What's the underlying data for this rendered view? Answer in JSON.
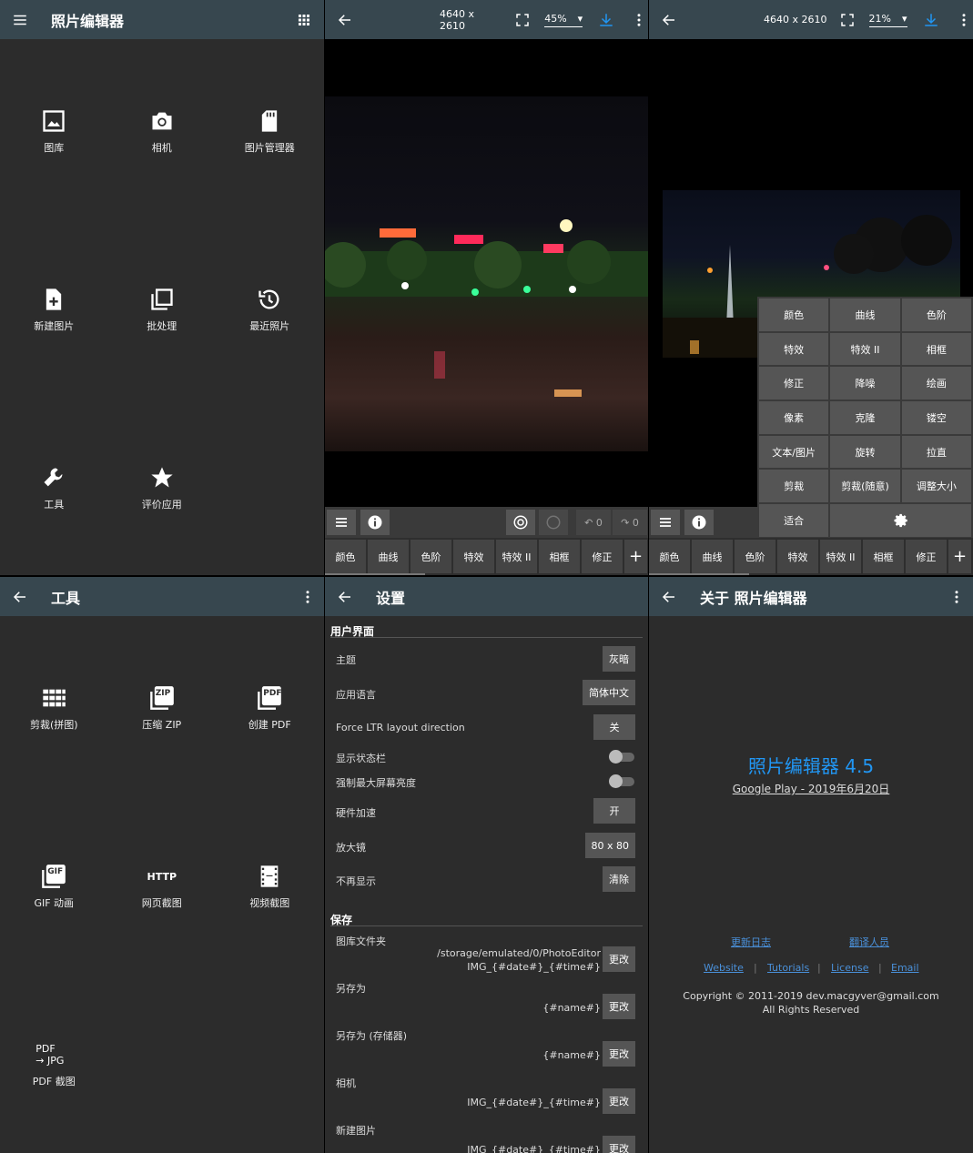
{
  "home": {
    "title": "照片编辑器",
    "items": [
      {
        "label": "图库",
        "icon": "image-icon"
      },
      {
        "label": "相机",
        "icon": "camera-icon"
      },
      {
        "label": "图片管理器",
        "icon": "sd-card-icon"
      },
      {
        "label": "新建图片",
        "icon": "new-file-icon"
      },
      {
        "label": "批处理",
        "icon": "stack-icon"
      },
      {
        "label": "最近照片",
        "icon": "history-icon"
      },
      {
        "label": "工具",
        "icon": "wrench-icon"
      },
      {
        "label": "评价应用",
        "icon": "star-icon"
      }
    ]
  },
  "editor1": {
    "dims": "4640 x 2610",
    "zoom": "45%",
    "undo": "0",
    "redo": "0",
    "tabs": [
      "颜色",
      "曲线",
      "色阶",
      "特效",
      "特效 II",
      "相框",
      "修正"
    ]
  },
  "editor2": {
    "dims": "4640 x 2610",
    "zoom": "21%",
    "tabs": [
      "颜色",
      "曲线",
      "色阶",
      "特效",
      "特效 II",
      "相框",
      "修正"
    ],
    "menu": [
      "颜色",
      "曲线",
      "色阶",
      "特效",
      "特效 II",
      "相框",
      "修正",
      "降噪",
      "绘画",
      "像素",
      "克隆",
      "镂空",
      "文本/图片",
      "旋转",
      "拉直",
      "剪裁",
      "剪裁(随意)",
      "调整大小",
      "适合"
    ]
  },
  "tools": {
    "title": "工具",
    "items": [
      {
        "label": "剪裁(拼图)",
        "icon": "grid-icon"
      },
      {
        "label": "压缩 ZIP",
        "icon": "zip-icon",
        "badge": "ZIP"
      },
      {
        "label": "创建 PDF",
        "icon": "pdf-icon",
        "badge": "PDF"
      },
      {
        "label": "GIF 动画",
        "icon": "gif-icon",
        "badge": "GIF"
      },
      {
        "label": "网页截图",
        "icon": "http-icon",
        "badge": "HTTP"
      },
      {
        "label": "视频截图",
        "icon": "film-icon"
      },
      {
        "label": "PDF 截图",
        "icon": "pdf-to-jpg-icon",
        "badge1": "PDF",
        "badge2": "→ JPG"
      }
    ]
  },
  "settings": {
    "title": "设置",
    "ui_section": "用户界面",
    "theme_label": "主题",
    "theme_value": "灰暗",
    "lang_label": "应用语言",
    "lang_value": "简体中文",
    "ltr_label": "Force LTR layout direction",
    "ltr_value": "关",
    "statusbar_label": "显示状态栏",
    "brightness_label": "强制最大屏幕亮度",
    "hw_label": "硬件加速",
    "hw_value": "开",
    "magnifier_label": "放大镜",
    "magnifier_value": "80 x 80",
    "nomore_label": "不再显示",
    "nomore_value": "清除",
    "save_section": "保存",
    "gallery_label": "图库文件夹",
    "gallery_path1": "/storage/emulated/0/PhotoEditor",
    "gallery_path2": "IMG_{#date#}_{#time#}",
    "saveas_label": "另存为",
    "saveas_value": "{#name#}",
    "saveas_storage_label": "另存为 (存储器)",
    "saveas_storage_value": "{#name#}",
    "camera_label": "相机",
    "camera_value": "IMG_{#date#}_{#time#}",
    "newimg_label": "新建图片",
    "newimg_value": "IMG_{#date#}_{#time#}",
    "change": "更改"
  },
  "about": {
    "title": "关于 照片编辑器",
    "app_name": "照片编辑器 4.5",
    "release": "Google Play - 2019年6月20日",
    "changelog": "更新日志",
    "translators": "翻译人员",
    "website": "Website",
    "tutorials": "Tutorials",
    "license": "License",
    "email": "Email",
    "sep": "|",
    "copyright": "Copyright © 2011-2019 dev.macgyver@gmail.com",
    "rights": "All Rights Reserved"
  },
  "colors": {
    "appbar": "#37474f",
    "accent": "#2196f3",
    "bg": "#2c2c2c"
  }
}
